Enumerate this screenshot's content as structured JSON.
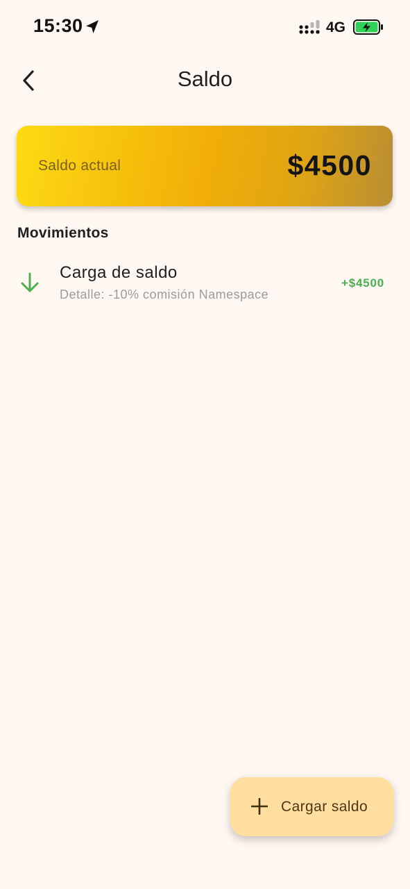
{
  "status_bar": {
    "time": "15:30",
    "network": "4G",
    "icons": {
      "location": "location-arrow-icon",
      "signal": "signal-dots-icon",
      "battery": "battery-charging-icon"
    },
    "battery_color": "#30D158"
  },
  "header": {
    "title": "Saldo",
    "back_icon": "chevron-left-icon"
  },
  "balance_card": {
    "label": "Saldo actual",
    "value": "$4500"
  },
  "movements": {
    "heading": "Movimientos",
    "items": [
      {
        "title": "Carga de saldo",
        "detail": "Detalle: -10% comisión Namespace",
        "amount": "+$4500",
        "icon": "arrow-down-icon",
        "color": "#4CAF50"
      }
    ]
  },
  "fab": {
    "label": "Cargar saldo",
    "icon": "plus-icon",
    "background": "#FFDEA0"
  },
  "colors": {
    "background": "#FFF7F1",
    "card_gradient_start": "#FDDB14",
    "card_gradient_end": "#B98E33",
    "positive": "#4CAF50"
  }
}
